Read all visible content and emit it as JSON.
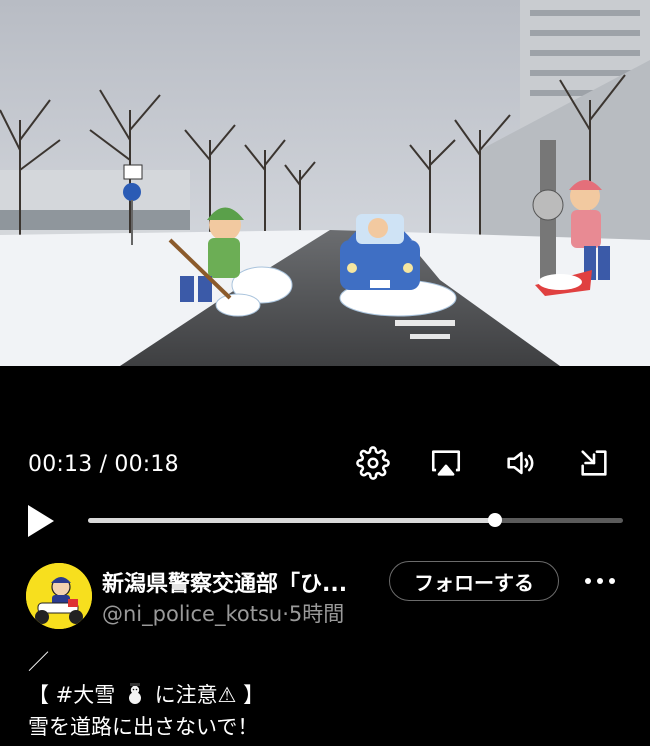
{
  "player": {
    "time_current": "00:13",
    "time_total": "00:18",
    "time_separator": " / ",
    "progress_fraction": 0.76,
    "icons": [
      "gear-icon",
      "airplay-icon",
      "volume-icon",
      "exit-fullscreen-icon",
      "play-icon"
    ]
  },
  "post": {
    "author_name": "新潟県警察交通部「ひ...",
    "handle": "@ni_police_kotsu",
    "dot": "·",
    "time_ago": "5時間",
    "follow_label": "フォローする",
    "more_label": "•••",
    "line1": "／",
    "line2_open": "【 #大雪 ",
    "line2_mid": " に注意",
    "line2_warn": "⚠",
    "line2_close": " 】",
    "line3": "雪を道路に出さないで！"
  }
}
